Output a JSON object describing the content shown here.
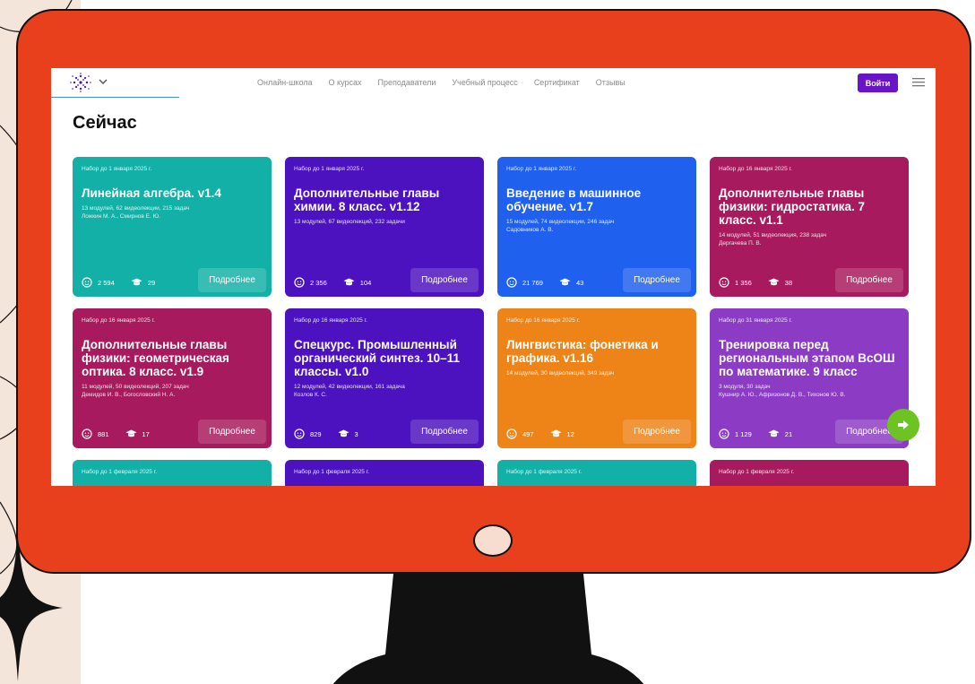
{
  "nav": {
    "links": [
      "Онлайн-школа",
      "О курсах",
      "Преподаватели",
      "Учебный процесс",
      "Сертификат",
      "Отзывы"
    ],
    "login": "Войти"
  },
  "page": {
    "title": "Сейчас"
  },
  "details_label": "Подробнее",
  "cards": [
    {
      "enroll": "Набор до 1 января 2025 г.",
      "title": "Линейная алгебра. v1.4",
      "meta1": "13 модулей, 62 видеолекции, 215 задач",
      "meta2": "Ложкин М. А., Смирнов Е. Ю.",
      "students": "2 594",
      "graduates": "29",
      "color": "#12b0a6"
    },
    {
      "enroll": "Набор до 1 января 2025 г.",
      "title": "Дополнительные главы химии. 8 класс. v1.12",
      "meta1": "13 модулей, 67 видеолекций, 232 задачи",
      "meta2": "",
      "students": "2 356",
      "graduates": "104",
      "color": "#4d12bf"
    },
    {
      "enroll": "Набор до 1 января 2025 г.",
      "title": "Введение в машинное обучение. v1.7",
      "meta1": "15 модулей, 74 видеолекции, 246 задач",
      "meta2": "Садовников А. В.",
      "students": "21 769",
      "graduates": "43",
      "color": "#2060ee"
    },
    {
      "enroll": "Набор до 16 января 2025 г.",
      "title": "Дополнительные главы физики: гидростатика. 7 класс. v1.1",
      "meta1": "14 модулей, 51 видеолекция, 238 задач",
      "meta2": "Дергачева П. В.",
      "students": "1 356",
      "graduates": "38",
      "color": "#a81a5e"
    },
    {
      "enroll": "Набор до 16 января 2025 г.",
      "title": "Дополнительные главы физики: геометрическая оптика. 8 класс. v1.9",
      "meta1": "11 модулей, 50 видеолекций, 207 задач",
      "meta2": "Демидов И. В., Богословский Н. А.",
      "students": "881",
      "graduates": "17",
      "color": "#a81a5e"
    },
    {
      "enroll": "Набор до 16 января 2025 г.",
      "title": "Спецкурс. Промышленный органический синтез. 10–11 классы. v1.0",
      "meta1": "12 модулей, 42 видеолекции, 161 задача",
      "meta2": "Козлов К. С.",
      "students": "829",
      "graduates": "3",
      "color": "#4d12bf"
    },
    {
      "enroll": "Набор до 16 января 2025 г.",
      "title": "Лингвистика: фонетика и графика. v1.16",
      "meta1": "14 модулей, 30 видеолекций, 349 задач",
      "meta2": "",
      "students": "497",
      "graduates": "12",
      "color": "#ee8418"
    },
    {
      "enroll": "Набор до 31 января 2025 г.",
      "title": "Тренировка перед региональным этапом ВсОШ по математике. 9 класс",
      "meta1": "3 модуля, 30 задач",
      "meta2": "Кушнир А. Ю., Афризонов Д. В., Тихонов Ю. В.",
      "students": "1 129",
      "graduates": "21",
      "color": "#8c3cc4"
    },
    {
      "enroll": "Набор до 1 февраля 2025 г.",
      "color": "#12b0a6"
    },
    {
      "enroll": "Набор до 1 февраля 2025 г.",
      "color": "#4d12bf"
    },
    {
      "enroll": "Набор до 1 февраля 2025 г.",
      "color": "#12b0a6"
    },
    {
      "enroll": "Набор до 1 февраля 2025 г.",
      "color": "#a81a5e"
    }
  ]
}
